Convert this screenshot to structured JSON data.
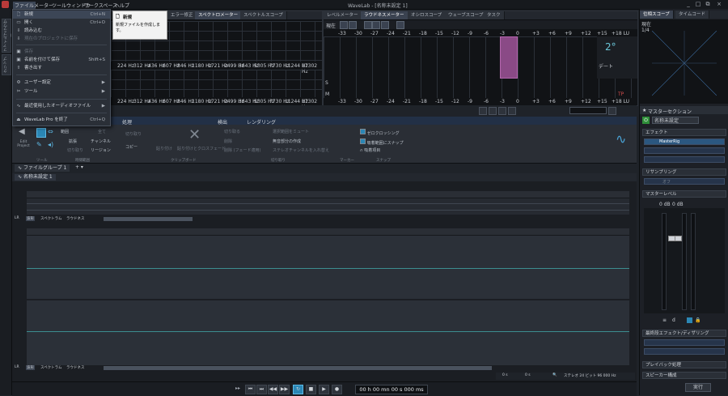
{
  "titlebar": {
    "menus": [
      "ファイル",
      "メーター",
      "ツールウィンドウ",
      "ワークスペース",
      "ヘルプ"
    ],
    "title": "WaveLab - [名称未設定 1]",
    "buttons": [
      "_",
      "□",
      "⧉",
      "×"
    ]
  },
  "left_tabs": [
    "ファイルブラウザー",
    "クリップ"
  ],
  "file_menu": {
    "items": [
      {
        "icon": "new-icon",
        "label": "新規",
        "shortcut": "Ctrl+N",
        "highlighted": true
      },
      {
        "icon": "open-icon",
        "label": "開く",
        "shortcut": "Ctrl+O"
      },
      {
        "icon": "import-icon",
        "label": "読み込む",
        "shortcut": ""
      },
      {
        "icon": "import-lib-icon",
        "label": "現在のプロジェクトに保存",
        "shortcut": "",
        "disabled": true
      },
      {
        "icon": "save-icon",
        "label": "保存",
        "shortcut": "",
        "disabled": true
      },
      {
        "icon": "saveas-icon",
        "label": "名前を付けて保存",
        "shortcut": "Shift+S"
      },
      {
        "icon": "export-icon",
        "label": "書き出す",
        "shortcut": ""
      },
      {
        "icon": "prefs-icon",
        "label": "ユーザー設定",
        "shortcut": "▶"
      },
      {
        "icon": "tools-icon",
        "label": "ツール",
        "shortcut": "▶"
      },
      {
        "icon": "recent-icon",
        "label": "最近使用したオーディオファイル",
        "shortcut": "▶"
      },
      {
        "icon": "exit-icon",
        "label": "WaveLab Pro を終了",
        "shortcut": "Ctrl+Q"
      }
    ]
  },
  "tooltip": {
    "title": "新規",
    "text": "新規ファイルを作成します。"
  },
  "top_tabs_left": [
    "エラー修正",
    "スペクトロメーター",
    "スペクトルスコープ"
  ],
  "top_tabs_mid": [
    "レベルメーター",
    "ラウドネスメーター",
    "オシロスコープ",
    "ウェーブスコープ",
    "タスク"
  ],
  "top_tabs_right": [
    "位相スコープ",
    "タイムコード"
  ],
  "spectrum_freqs": [
    "224 Hz",
    "312 Hz",
    "436 Hz",
    "607 Hz",
    "846 Hz",
    "1180 Hz",
    "1721 Hz",
    "2499 Hz",
    "3643 Hz",
    "5305 Hz",
    "7730 Hz",
    "11244 Hz",
    "17302 Hz"
  ],
  "loudness": {
    "mode_label": "現在",
    "scale": [
      "-33",
      "-30",
      "-27",
      "-24",
      "-21",
      "-18",
      "-15",
      "-12",
      "-9",
      "-6",
      "-3",
      "0",
      "+3",
      "+6",
      "+9",
      "+12",
      "+15",
      "+18 LU"
    ],
    "row_labels": [
      "S",
      "M"
    ],
    "side_label": "デート",
    "tp_label": "TP"
  },
  "phase_scope": {
    "label": "現在",
    "ratio": "1/4"
  },
  "editor_tabs": [
    "処理",
    "検出",
    "レンダリング"
  ],
  "ribbon": {
    "edit_project": "Edit Project",
    "groups": [
      "ツール",
      "時間範囲",
      "クリップボード",
      "切り取り",
      "マーカー",
      "スナップ"
    ],
    "items_a": [
      "範囲",
      "拡張",
      "全て",
      "チャンネル",
      "切り取り",
      "リージョン"
    ],
    "items_b": [
      "切り取り",
      "コピー",
      "貼り付け",
      "貼り付けとクロスフェード"
    ],
    "items_c": [
      "切り取る",
      "削除",
      "削除 (フェード適用)",
      "選択範囲をミュート",
      "無音部分の作成",
      "ステレオチャンネルを入れ替え"
    ],
    "checks": [
      "ゼロクロッシング",
      "吸着範囲にスナップ",
      "吸着項目"
    ]
  },
  "filegroup_tab": "ファイルグループ 1",
  "file_tab": "名称未設定 1",
  "view_tabs": [
    "波形",
    "スペクトラム",
    "ラウドネス"
  ],
  "status": {
    "format": "ステレオ 24 ビット 96 000 Hz",
    "zoom_a": "0 s",
    "zoom_b": "0 s"
  },
  "transport": {
    "time": "00 h 00 mn 00 s 000 ms"
  },
  "master": {
    "header": "マスターセクション",
    "preset": "名称未設定",
    "effects": "エフェクト",
    "effect_name": "MasterRig",
    "resampling": "リサンプリング",
    "resampling_value": "オフ",
    "level": "マスターレベル",
    "db_left": "0 dB",
    "db_right": "0 dB",
    "final": "最終段エフェクト/ディザリング",
    "playback": "プレイバック処理",
    "speaker": "スピーカー構成",
    "run": "実行"
  }
}
